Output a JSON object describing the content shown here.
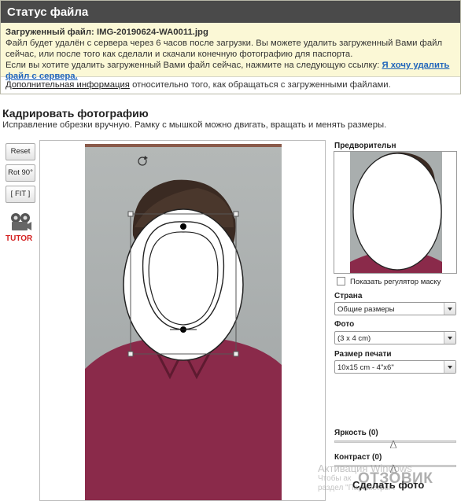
{
  "status": {
    "title": "Статус файла",
    "uploaded_label": "Загруженный файл:",
    "uploaded_filename": "IMG-20190624-WA0011.jpg",
    "line1": "Файл будет удалён с сервера через 6 часов после загрузки. Вы можете удалить загруженный Вами файл",
    "line2": "сейчас, или после того как сделали и скачали конечную фотографию для паспорта.",
    "line3_text": "Если вы хотите удалить загруженный Вами файл сейчас, нажмите на следующую ссылку:",
    "delete_link_part1": "Я хочу удалить",
    "delete_link_part2": "файл с сервера.",
    "more_info_link": "Дополнительная информация",
    "more_info_text": "относительно того, как обращаться с загруженными файлами."
  },
  "section": {
    "title": "Кадрировать фотографию",
    "subtitle": "Исправление обрезки вручную. Рамку с мышкой можно двигать, вращать и менять размеры."
  },
  "tools": {
    "reset": "Reset",
    "rotate": "Rot 90°",
    "fit": "[ FIT ]",
    "tutor": "TUTOR",
    "tutor_icon": "film-camera-icon"
  },
  "panel": {
    "preview_label": "Предворительн",
    "mask_checkbox_label": "Показать регулятор маску",
    "country_label": "Страна",
    "country_value": "Общие размеры",
    "photo_label": "Фото",
    "photo_value": "(3 x 4 cm)",
    "print_label": "Размер печати",
    "print_value": "10x15 cm - 4\"x6\"",
    "brightness_label": "Яркость (0)",
    "brightness_value": 0,
    "contrast_label": "Контраст (0)",
    "contrast_value": 0,
    "make_button": "Сделать фото"
  },
  "overlay": {
    "activate_windows": "Активация Windows",
    "activate_hint1": "Чтобы ак",
    "activate_hint2": "раздел \"Параметры\".",
    "site_watermark": "ОТЗОВИК"
  },
  "colors": {
    "status_header": "#4a4a4a",
    "status_body": "#fbf8d6",
    "link": "#2266bb",
    "tutor_red": "#d42020",
    "shirt": "#8a2a4a"
  }
}
